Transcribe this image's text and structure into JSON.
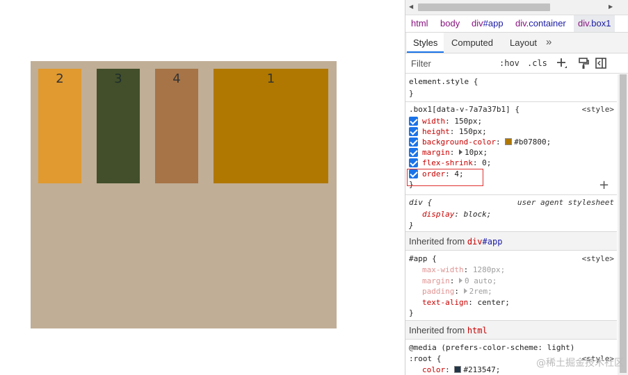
{
  "preview": {
    "boxes": [
      {
        "label": "2"
      },
      {
        "label": "3"
      },
      {
        "label": "4"
      },
      {
        "label": "1"
      }
    ]
  },
  "breadcrumbs": [
    {
      "tag": "html",
      "rest": ""
    },
    {
      "tag": "body",
      "rest": ""
    },
    {
      "tag": "div",
      "rest": "#app"
    },
    {
      "tag": "div",
      "rest": ".container"
    },
    {
      "tag": "div",
      "rest": ".box1"
    }
  ],
  "tabs": {
    "styles": "Styles",
    "computed": "Computed",
    "layout": "Layout",
    "more": "»"
  },
  "filter": {
    "placeholder": "Filter",
    "hov": ":hov",
    "cls": ".cls"
  },
  "element_style": {
    "selector": "element.style {",
    "close": "}"
  },
  "box1_rule": {
    "selector": ".box1[data-v-7a7a37b1] {",
    "source": "<style>",
    "declarations": [
      {
        "prop": "width",
        "value": "150px;"
      },
      {
        "prop": "height",
        "value": "150px;"
      },
      {
        "prop": "background-color",
        "value": "#b07800;",
        "swatch": "#b07800"
      },
      {
        "prop": "margin",
        "value": "10px;",
        "expand": true
      },
      {
        "prop": "flex-shrink",
        "value": "0;"
      },
      {
        "prop": "order",
        "value": "4;"
      }
    ],
    "close": "}"
  },
  "ua_rule": {
    "selector": "div {",
    "source": "user agent stylesheet",
    "prop": "display",
    "value": "block;",
    "close": "}"
  },
  "inherited_app": {
    "label": "Inherited from",
    "tag": "div",
    "rest": "#app",
    "selector": "#app {",
    "source": "<style>",
    "declarations": [
      {
        "prop": "max-width",
        "value": "1280px;",
        "inherited": true
      },
      {
        "prop": "margin",
        "value": "0 auto;",
        "inherited": true,
        "expand": true
      },
      {
        "prop": "padding",
        "value": "2rem;",
        "inherited": true,
        "expand": true
      },
      {
        "prop": "text-align",
        "value": "center;",
        "inherited": false
      }
    ],
    "close": "}"
  },
  "inherited_html": {
    "label": "Inherited from",
    "tag": "html",
    "media": "@media (prefers-color-scheme: light)",
    "selector": ":root {",
    "source": "<style>",
    "prop": "color",
    "value": "#213547;",
    "swatch": "#213547"
  },
  "watermark": "@稀土掘金技术社区"
}
